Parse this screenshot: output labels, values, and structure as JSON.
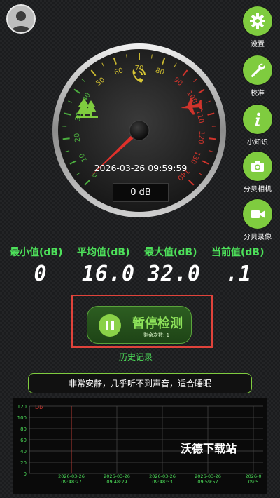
{
  "header": {
    "avatar_icon": "user-avatar"
  },
  "side_buttons": [
    {
      "label": "设置",
      "icon": "gear-icon"
    },
    {
      "label": "校准",
      "icon": "wrench-icon"
    },
    {
      "label": "小知识",
      "icon": "info-icon"
    },
    {
      "label": "分贝相机",
      "icon": "camera-icon"
    },
    {
      "label": "分贝录像",
      "icon": "video-icon"
    }
  ],
  "gauge": {
    "ticks": [
      "0",
      "10",
      "20",
      "30",
      "40",
      "50",
      "60",
      "70",
      "80",
      "90",
      "100",
      "110",
      "120",
      "130",
      "140"
    ],
    "needle_db": 1,
    "max_db": 140,
    "datetime": "2026-03-26 09:59:59",
    "current_display": "0 dB",
    "zone_icons": [
      "tree-icon",
      "phone-icon",
      "airplane-icon"
    ]
  },
  "stats": {
    "min_label": "最小值(dB)",
    "min_value": "0",
    "avg_label": "平均值(dB)",
    "avg_value": "16.0",
    "max_label": "最大值(dB)",
    "max_value": "32.0",
    "cur_label": "当前值(dB)",
    "cur_value": ".1"
  },
  "control": {
    "pause_label": "暂停检测",
    "remaining": "剩余次数: 1",
    "history_link": "历史记录"
  },
  "description": "非常安静，几乎听不到声音，适合睡眠",
  "chart_data": {
    "type": "line",
    "ylabel": "Db",
    "y_ticks": [
      "120",
      "100",
      "80",
      "60",
      "40",
      "20",
      "0"
    ],
    "ylim": [
      0,
      120
    ],
    "x_labels": [
      [
        "2026-03-26",
        "09:48:27"
      ],
      [
        "2026-03-26",
        "09:48:29"
      ],
      [
        "2026-03-26",
        "09:48:33"
      ],
      [
        "2026-03-26",
        "09:59:57"
      ],
      [
        "2026-0",
        "09:5"
      ]
    ],
    "marker_x_index": 0
  },
  "watermark": "沃德下载站",
  "colors": {
    "accent_green": "#7fcc3f",
    "highlight_red": "#e0433b",
    "gauge_green": "#4caf3f",
    "gauge_red": "#d0342c"
  }
}
